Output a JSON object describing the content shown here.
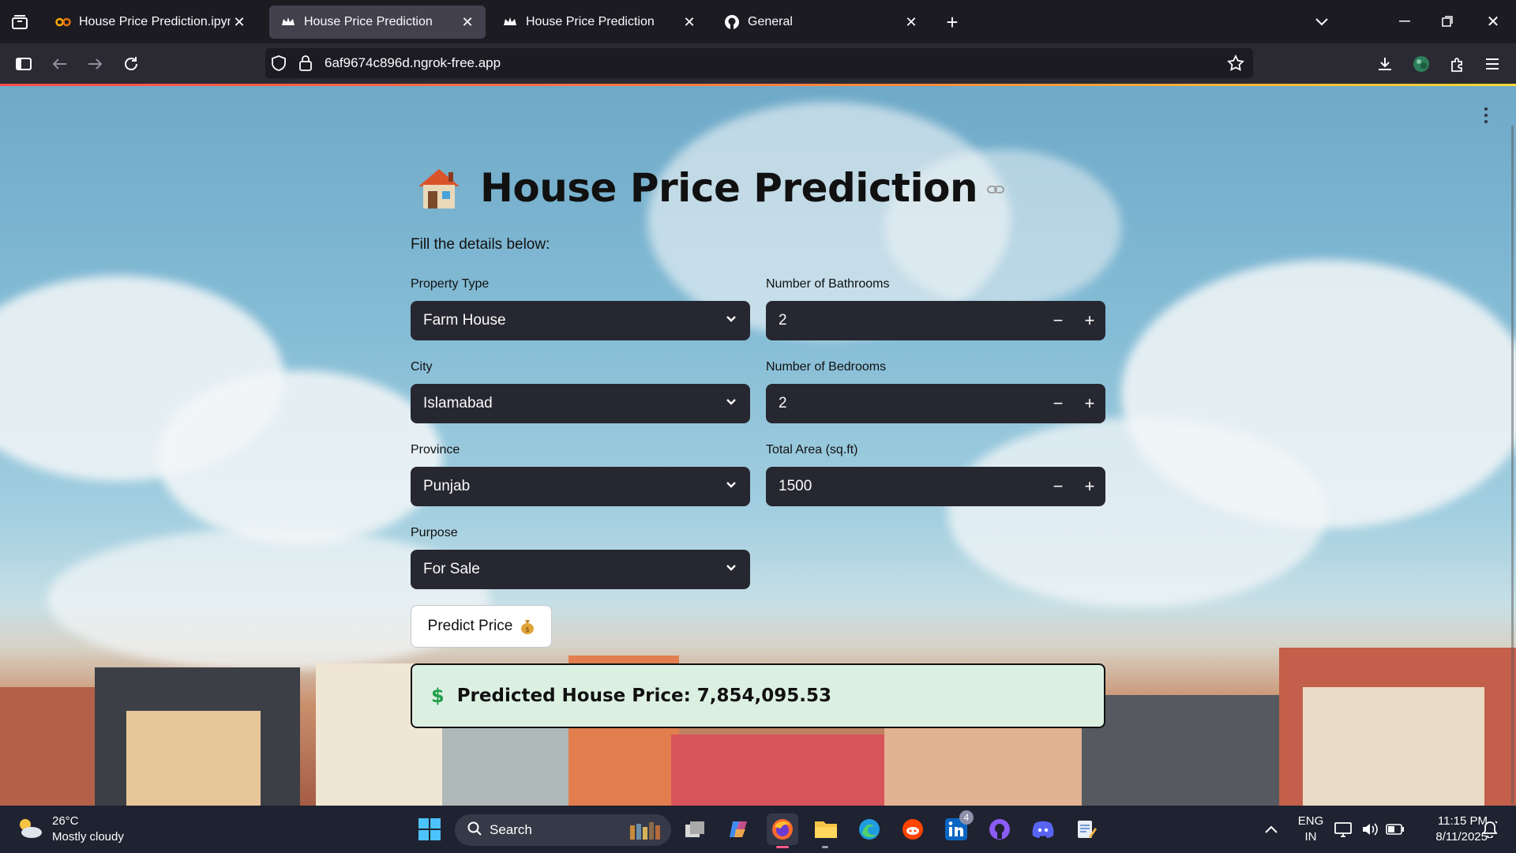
{
  "browser": {
    "tabs": [
      {
        "title": "House Price Prediction.ipynb - C",
        "icon": "colab-icon",
        "active": false
      },
      {
        "title": "House Price Prediction",
        "icon": "streamlit-crown-icon",
        "active": true
      },
      {
        "title": "House Price Prediction",
        "icon": "streamlit-crown-icon",
        "active": false
      },
      {
        "title": "General",
        "icon": "github-icon",
        "active": false
      }
    ],
    "url": "6af9674c896d.ngrok-free.app"
  },
  "page": {
    "title": "House Price Prediction",
    "subtitle": "Fill the details below:",
    "fields": {
      "property_type": {
        "label": "Property Type",
        "value": "Farm House"
      },
      "city": {
        "label": "City",
        "value": "Islamabad"
      },
      "province": {
        "label": "Province",
        "value": "Punjab"
      },
      "purpose": {
        "label": "Purpose",
        "value": "For Sale"
      },
      "bathrooms": {
        "label": "Number of Bathrooms",
        "value": "2"
      },
      "bedrooms": {
        "label": "Number of Bedrooms",
        "value": "2"
      },
      "area": {
        "label": "Total Area (sq.ft)",
        "value": "1500"
      }
    },
    "stepper": {
      "minus": "−",
      "plus": "+"
    },
    "predict_button": "Predict Price",
    "result": {
      "icon": "$",
      "text": "Predicted House Price: 7,854,095.53"
    },
    "colors": {
      "input_bg": "#262730",
      "result_bg": "#dcf0e2",
      "result_icon": "#21a04b"
    }
  },
  "taskbar": {
    "weather": {
      "temp": "26°C",
      "desc": "Mostly cloudy"
    },
    "search_label": "Search",
    "linkedin_badge": "4",
    "lang": {
      "line1": "ENG",
      "line2": "IN"
    },
    "clock": {
      "time": "11:15 PM",
      "date": "8/11/2025"
    }
  }
}
